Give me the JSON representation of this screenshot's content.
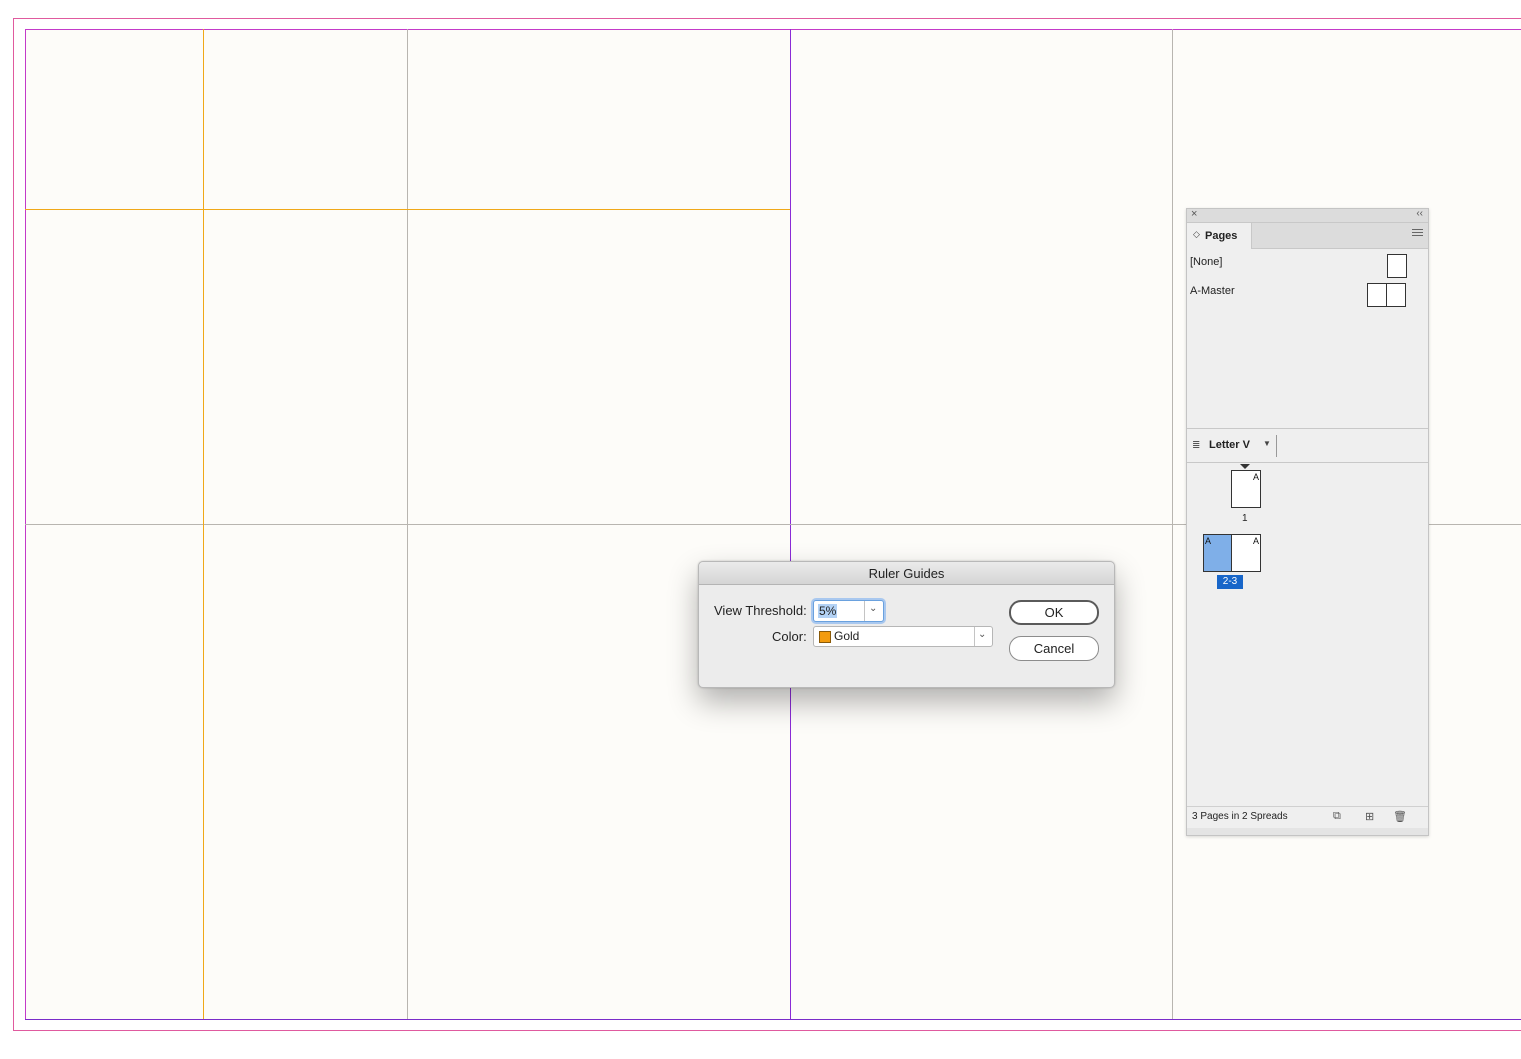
{
  "colors": {
    "bleed": "#e05a9e",
    "margin": "#c33ac9",
    "spine": "#8a2bd6",
    "column": "#b8b5b0",
    "guide_gold": "#f0a818",
    "selected_spread": "#1866c9",
    "selected_page": "#7fafe8"
  },
  "pages_panel": {
    "tab_label": "Pages",
    "close_icon": "×",
    "collapse_icon": "‹‹",
    "masters": [
      {
        "label": "[None]"
      },
      {
        "label": "A-Master"
      }
    ],
    "page_size": "Letter V",
    "page_numbers": [
      "1"
    ],
    "spread_label": "2-3",
    "master_letter": "A",
    "footer_text": "3 Pages in 2 Spreads"
  },
  "dialog": {
    "title": "Ruler Guides",
    "view_threshold_label": "View Threshold:",
    "view_threshold_value": "5%",
    "color_label": "Color:",
    "color_value": "Gold",
    "ok_label": "OK",
    "cancel_label": "Cancel"
  }
}
